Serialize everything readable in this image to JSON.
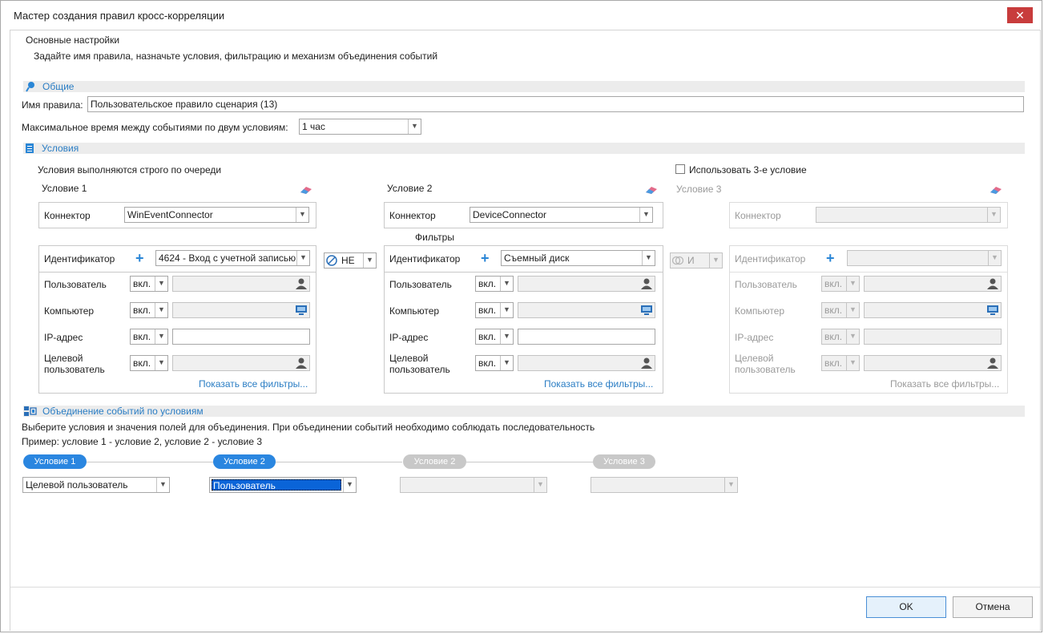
{
  "window": {
    "title": "Мастер создания правил кросс-корреляции",
    "close_glyph": "✕"
  },
  "header": {
    "title": "Основные настройки",
    "subtitle": "Задайте имя правила, назначьте условия, фильтрацию и механизм объединения событий"
  },
  "general": {
    "section_label": "Общие",
    "rule_name_label": "Имя правила:",
    "rule_name_value": "Пользовательское правило сценария (13)",
    "max_time_label": "Максимальное время между событиями по двум условиям:",
    "max_time_value": "1 час"
  },
  "conditions": {
    "section_label": "Условия",
    "order_note": "Условия выполняются строго по очереди",
    "use_third_label": "Использовать 3-е условие",
    "filters_label": "Фильтры",
    "op1": "НЕ",
    "op2": "И",
    "connector_label": "Коннектор",
    "identifier_label": "Идентификатор",
    "user_label": "Пользователь",
    "computer_label": "Компьютер",
    "ip_label": "IP-адрес",
    "target_user_label_1": "Целевой",
    "target_user_label_2": "пользователь",
    "incl_value": "вкл.",
    "show_all_filters": "Показать все фильтры...",
    "c1": {
      "title": "Условие 1",
      "connector": "WinEventConnector",
      "identifier": "4624 - Вход с учетной записью"
    },
    "c2": {
      "title": "Условие 2",
      "connector": "DeviceConnector",
      "identifier": "Съемный диск"
    },
    "c3": {
      "title": "Условие 3",
      "connector": "",
      "identifier": ""
    }
  },
  "merge": {
    "section_label": "Объединение событий по условиям",
    "desc": "Выберите условия и значения полей для объединения. При объединении событий необходимо соблюдать последовательность",
    "example": "Пример: условие 1 - условие 2, условие 2 - условие 3",
    "pills": [
      "Условие 1",
      "Условие 2",
      "Условие 2",
      "Условие 3"
    ],
    "fields": [
      "Целевой пользователь",
      "Пользователь",
      "",
      ""
    ]
  },
  "footer": {
    "ok": "OK",
    "cancel": "Отмена"
  },
  "colors": {
    "accent": "#2a86e0",
    "link": "#2a7dc4",
    "close": "#c83c3c"
  }
}
